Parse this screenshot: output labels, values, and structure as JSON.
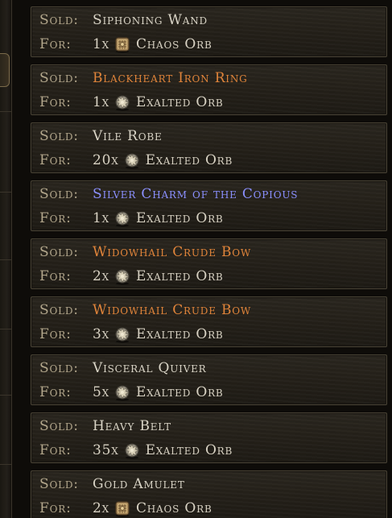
{
  "labels": {
    "sold": "Sold:",
    "for": "For:"
  },
  "colors": {
    "normal": "#d9d4c6",
    "rare": "#e0843a",
    "magic": "#8b90ff"
  },
  "entries": [
    {
      "item": "Siphoning Wand",
      "rarity": "normal",
      "qty": "1x",
      "currency": "Chaos Orb",
      "currency_icon": "chaos-orb-icon"
    },
    {
      "item": "Blackheart Iron Ring",
      "rarity": "rare",
      "qty": "1x",
      "currency": "Exalted Orb",
      "currency_icon": "exalted-orb-icon"
    },
    {
      "item": "Vile Robe",
      "rarity": "normal",
      "qty": "20x",
      "currency": "Exalted Orb",
      "currency_icon": "exalted-orb-icon"
    },
    {
      "item": "Silver Charm of the Copious",
      "rarity": "magic",
      "qty": "1x",
      "currency": "Exalted Orb",
      "currency_icon": "exalted-orb-icon"
    },
    {
      "item": "Widowhail Crude Bow",
      "rarity": "rare",
      "qty": "2x",
      "currency": "Exalted Orb",
      "currency_icon": "exalted-orb-icon"
    },
    {
      "item": "Widowhail Crude Bow",
      "rarity": "rare",
      "qty": "3x",
      "currency": "Exalted Orb",
      "currency_icon": "exalted-orb-icon"
    },
    {
      "item": "Visceral Quiver",
      "rarity": "normal",
      "qty": "5x",
      "currency": "Exalted Orb",
      "currency_icon": "exalted-orb-icon"
    },
    {
      "item": "Heavy Belt",
      "rarity": "normal",
      "qty": "35x",
      "currency": "Exalted Orb",
      "currency_icon": "exalted-orb-icon"
    },
    {
      "item": "Gold Amulet",
      "rarity": "normal",
      "qty": "2x",
      "currency": "Chaos Orb",
      "currency_icon": "chaos-orb-icon"
    }
  ]
}
